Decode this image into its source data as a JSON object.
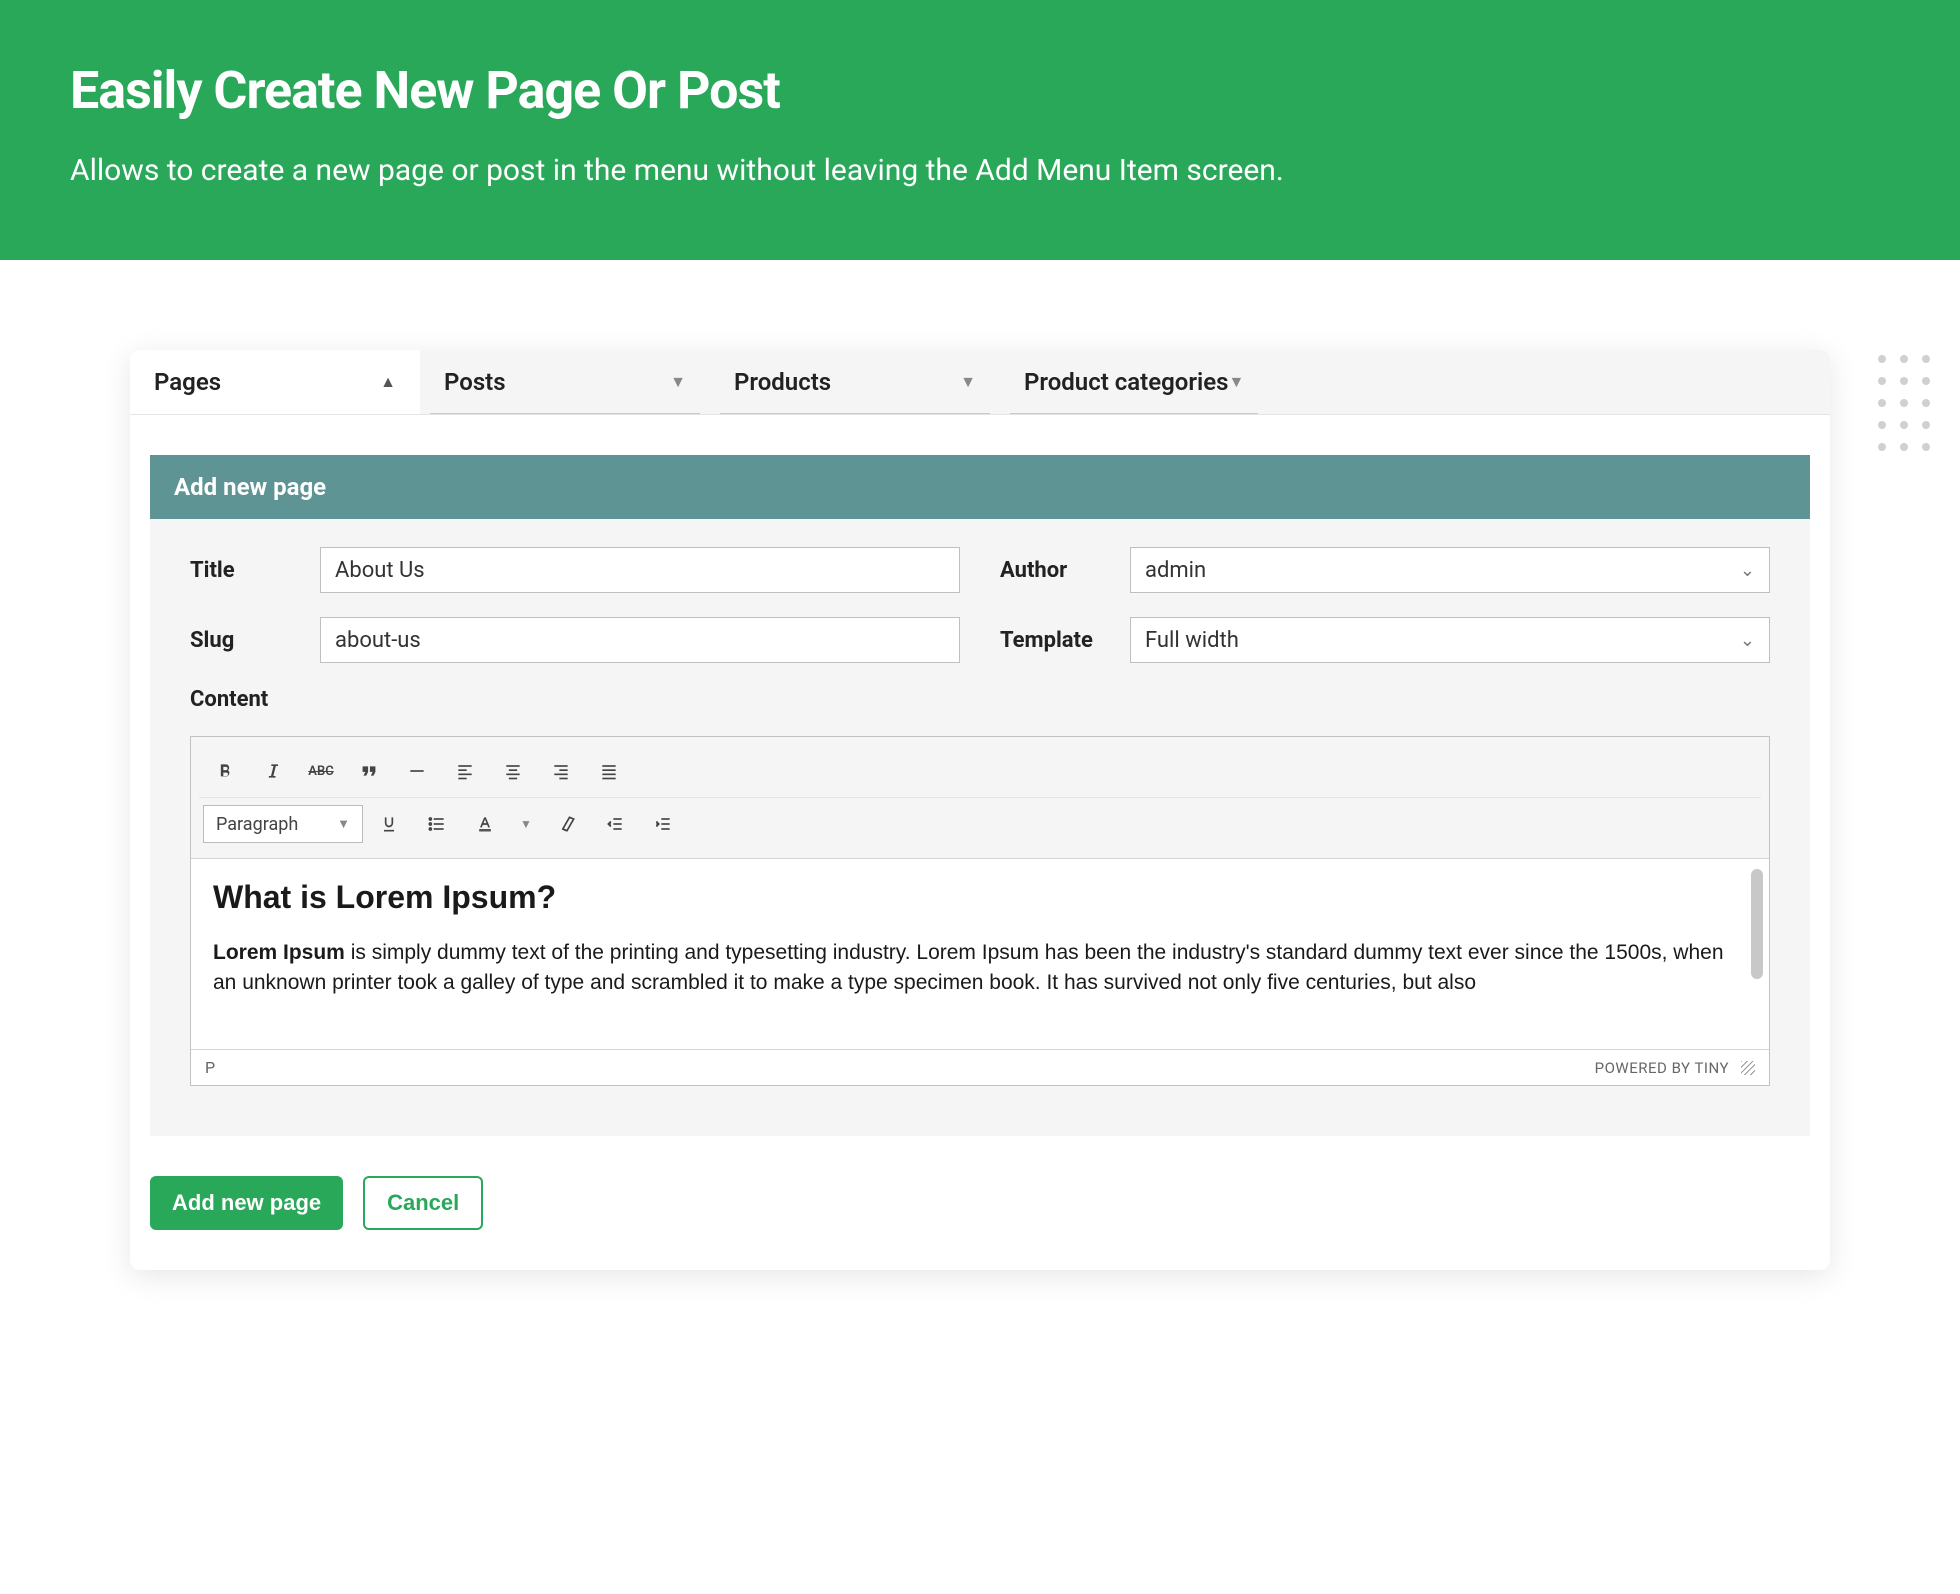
{
  "hero": {
    "title": "Easily Create New Page Or Post",
    "subtitle": "Allows to create a new page or post in the menu without leaving the Add Menu Item screen."
  },
  "tabs": [
    {
      "label": "Pages",
      "active": true
    },
    {
      "label": "Posts",
      "active": false
    },
    {
      "label": "Products",
      "active": false
    },
    {
      "label": "Product categories",
      "active": false
    }
  ],
  "panel": {
    "header": "Add new page",
    "fields": {
      "title_label": "Title",
      "title_value": "About Us",
      "slug_label": "Slug",
      "slug_value": "about-us",
      "author_label": "Author",
      "author_value": "admin",
      "template_label": "Template",
      "template_value": "Full width",
      "content_label": "Content"
    },
    "editor": {
      "block_format": "Paragraph",
      "heading": "What is Lorem Ipsum?",
      "body_strong": "Lorem Ipsum",
      "body_rest": " is simply dummy text of the printing and typesetting industry. Lorem Ipsum has been the industry's standard dummy text ever since the 1500s, when an unknown printer took a galley of type and scrambled it to make a type specimen book. It has survived not only five centuries, but also",
      "path": "P",
      "powered": "POWERED BY TINY"
    },
    "actions": {
      "primary": "Add new page",
      "secondary": "Cancel"
    }
  }
}
